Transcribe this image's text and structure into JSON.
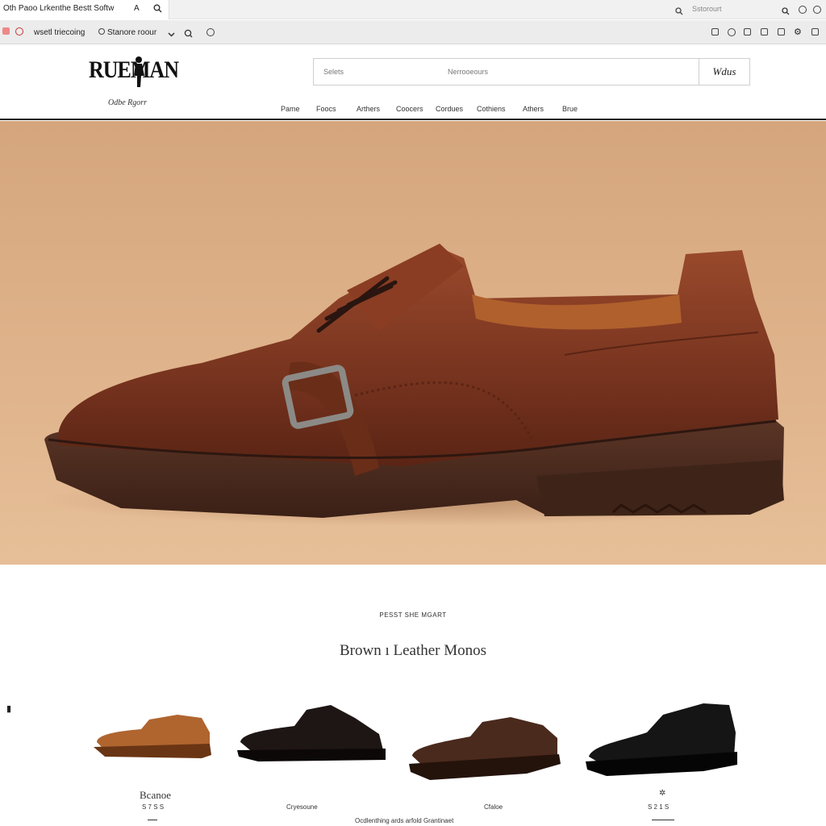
{
  "browser": {
    "tab_title": "Oth Paoo Lrkenthe Bestt Softw",
    "tab_letter": "A",
    "omnibox_placeholder": "Sstorourt",
    "toolbar_left": "wsetl triecoing",
    "toolbar_profile": "Stanore roour"
  },
  "header": {
    "logo_text": "RUEMAN",
    "logo_tagline": "Odbe Rgorr",
    "search_left": "Selets",
    "search_placeholder": "Nerrooeours",
    "search_button": "Wdus",
    "nav": [
      "Pame",
      "Foocs",
      "Arthers",
      "Coocers",
      "Cordues",
      "Cothiens",
      "Athers",
      "Brue"
    ]
  },
  "section": {
    "eyebrow": "PESST SHE MGART",
    "title": "Brown ı Leather Monos",
    "side_icon": "▮"
  },
  "products": [
    {
      "name": "Bcanoe",
      "sub": "S 7 S S",
      "color": "#b0652f",
      "dark": "#6a3514"
    },
    {
      "name": "",
      "sub": "Cryesoune",
      "color": "#1e1614",
      "dark": "#0c0807"
    },
    {
      "name": "",
      "sub": "Cfaloe",
      "color": "#4a2a1c",
      "dark": "#24130b"
    },
    {
      "name": "",
      "sub": "S 2 1 S",
      "color": "#151515",
      "dark": "#050505"
    }
  ],
  "footer_text": "Ocdlenthing ards arfold Grantinaet",
  "colors": {
    "hero_bg": "#dcae86",
    "shoe_leather": "#7a3520",
    "sole": "#4a2a1e"
  }
}
